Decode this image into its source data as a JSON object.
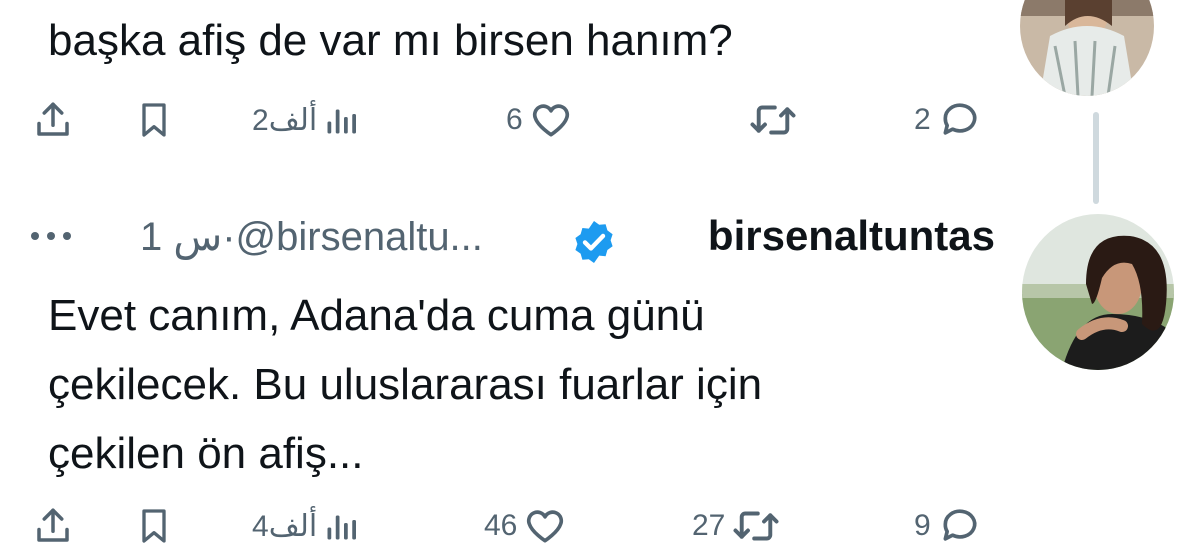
{
  "reply_above": {
    "text": "başka afiş de var mı birsen hanım?",
    "actions": {
      "views": "2ألف",
      "likes": "6",
      "retweets": "",
      "replies": "2"
    }
  },
  "tweet": {
    "display_name": "birsenaltuntas",
    "handle": "@birsenaltu...",
    "separator": "·",
    "time": "1 س",
    "verified": true,
    "text_lines": [
      "Evet canım, Adana'da cuma günü",
      "çekilecek. Bu uluslararası fuarlar için",
      "çekilen ön afiş..."
    ],
    "actions": {
      "views": "4ألف",
      "likes": "46",
      "retweets": "27",
      "replies": "9"
    }
  },
  "icons": {
    "share": "share-icon",
    "bookmark": "bookmark-icon",
    "views": "views-icon",
    "like": "heart-icon",
    "retweet": "retweet-icon",
    "reply": "reply-icon",
    "more": "more-icon",
    "verified": "verified-badge-icon"
  },
  "colors": {
    "text": "#0f1419",
    "muted": "#536471",
    "verified": "#1d9bf0",
    "thread_line": "#cfd9de"
  }
}
